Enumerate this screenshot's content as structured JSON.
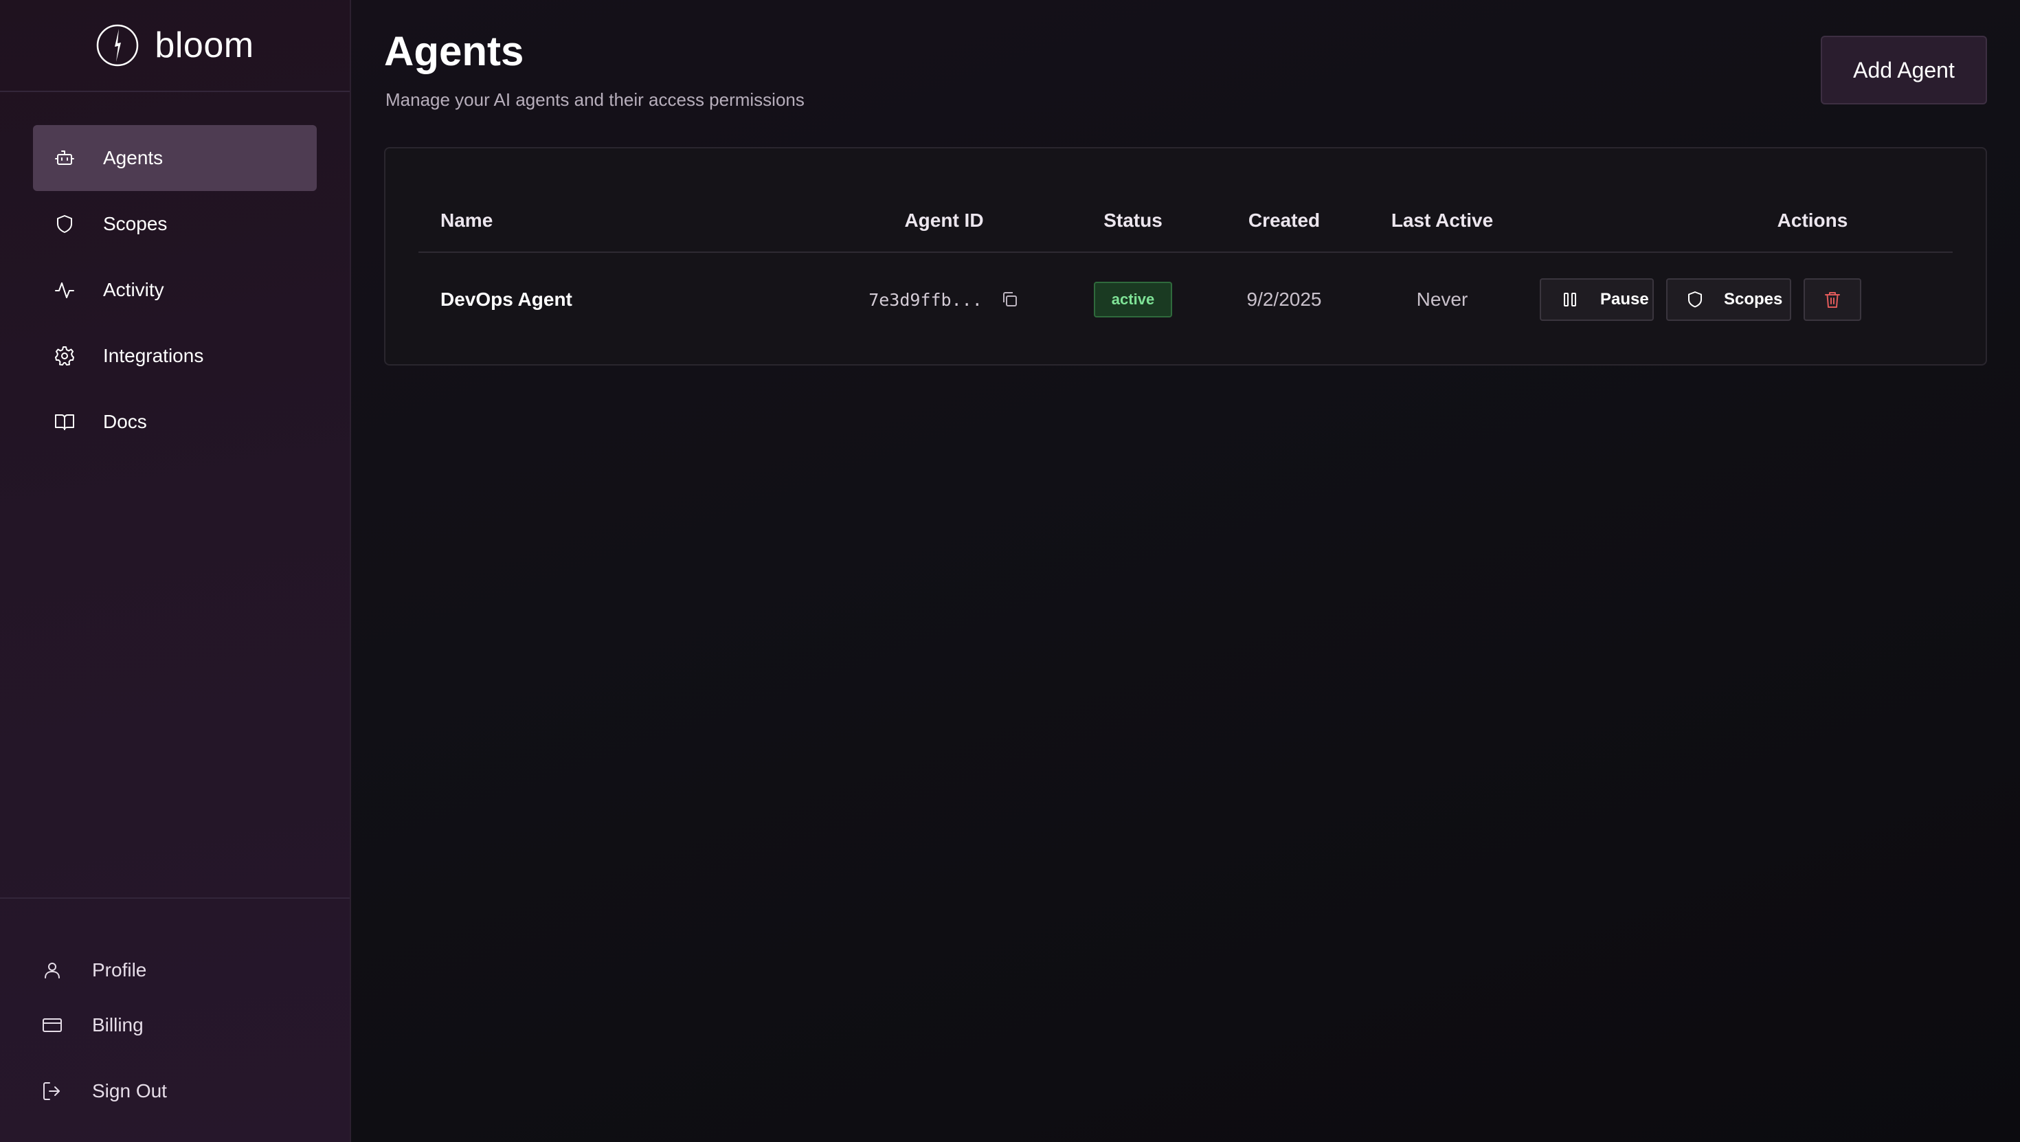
{
  "brand": {
    "name": "bloom"
  },
  "sidebar": {
    "items": [
      {
        "label": "Agents",
        "icon": "bot-icon",
        "active": true
      },
      {
        "label": "Scopes",
        "icon": "shield-icon"
      },
      {
        "label": "Activity",
        "icon": "activity-icon"
      },
      {
        "label": "Integrations",
        "icon": "gear-icon"
      },
      {
        "label": "Docs",
        "icon": "book-icon"
      }
    ],
    "bottom": [
      {
        "label": "Profile",
        "icon": "user-icon"
      },
      {
        "label": "Billing",
        "icon": "credit-card-icon"
      },
      {
        "label": "Sign Out",
        "icon": "sign-out-icon"
      }
    ]
  },
  "page": {
    "title": "Agents",
    "subtitle": "Manage your AI agents and their access permissions",
    "add_label": "Add Agent"
  },
  "table": {
    "headers": [
      "Name",
      "Agent ID",
      "Status",
      "Created",
      "Last Active",
      "Actions"
    ],
    "rows": [
      {
        "name": "DevOps Agent",
        "agent_id": "7e3d9ffb...",
        "status": "active",
        "created": "9/2/2025",
        "last_active": "Never",
        "actions": {
          "pause": "Pause",
          "scopes": "Scopes"
        }
      }
    ]
  },
  "colors": {
    "accent_active_bg": "#4e3c52",
    "status_active_text": "#7fe397",
    "status_active_bg": "#1a3a22",
    "delete_icon": "#e05a5a"
  }
}
